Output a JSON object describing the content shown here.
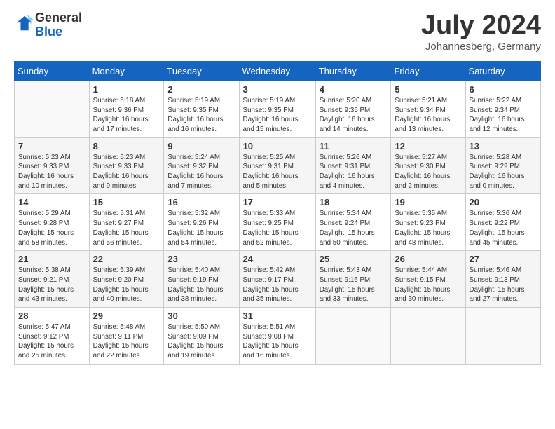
{
  "logo": {
    "general": "General",
    "blue": "Blue"
  },
  "title": "July 2024",
  "location": "Johannesberg, Germany",
  "days_of_week": [
    "Sunday",
    "Monday",
    "Tuesday",
    "Wednesday",
    "Thursday",
    "Friday",
    "Saturday"
  ],
  "weeks": [
    [
      {
        "number": "",
        "info": ""
      },
      {
        "number": "1",
        "info": "Sunrise: 5:18 AM\nSunset: 9:36 PM\nDaylight: 16 hours\nand 17 minutes."
      },
      {
        "number": "2",
        "info": "Sunrise: 5:19 AM\nSunset: 9:35 PM\nDaylight: 16 hours\nand 16 minutes."
      },
      {
        "number": "3",
        "info": "Sunrise: 5:19 AM\nSunset: 9:35 PM\nDaylight: 16 hours\nand 15 minutes."
      },
      {
        "number": "4",
        "info": "Sunrise: 5:20 AM\nSunset: 9:35 PM\nDaylight: 16 hours\nand 14 minutes."
      },
      {
        "number": "5",
        "info": "Sunrise: 5:21 AM\nSunset: 9:34 PM\nDaylight: 16 hours\nand 13 minutes."
      },
      {
        "number": "6",
        "info": "Sunrise: 5:22 AM\nSunset: 9:34 PM\nDaylight: 16 hours\nand 12 minutes."
      }
    ],
    [
      {
        "number": "7",
        "info": "Sunrise: 5:23 AM\nSunset: 9:33 PM\nDaylight: 16 hours\nand 10 minutes."
      },
      {
        "number": "8",
        "info": "Sunrise: 5:23 AM\nSunset: 9:33 PM\nDaylight: 16 hours\nand 9 minutes."
      },
      {
        "number": "9",
        "info": "Sunrise: 5:24 AM\nSunset: 9:32 PM\nDaylight: 16 hours\nand 7 minutes."
      },
      {
        "number": "10",
        "info": "Sunrise: 5:25 AM\nSunset: 9:31 PM\nDaylight: 16 hours\nand 5 minutes."
      },
      {
        "number": "11",
        "info": "Sunrise: 5:26 AM\nSunset: 9:31 PM\nDaylight: 16 hours\nand 4 minutes."
      },
      {
        "number": "12",
        "info": "Sunrise: 5:27 AM\nSunset: 9:30 PM\nDaylight: 16 hours\nand 2 minutes."
      },
      {
        "number": "13",
        "info": "Sunrise: 5:28 AM\nSunset: 9:29 PM\nDaylight: 16 hours\nand 0 minutes."
      }
    ],
    [
      {
        "number": "14",
        "info": "Sunrise: 5:29 AM\nSunset: 9:28 PM\nDaylight: 15 hours\nand 58 minutes."
      },
      {
        "number": "15",
        "info": "Sunrise: 5:31 AM\nSunset: 9:27 PM\nDaylight: 15 hours\nand 56 minutes."
      },
      {
        "number": "16",
        "info": "Sunrise: 5:32 AM\nSunset: 9:26 PM\nDaylight: 15 hours\nand 54 minutes."
      },
      {
        "number": "17",
        "info": "Sunrise: 5:33 AM\nSunset: 9:25 PM\nDaylight: 15 hours\nand 52 minutes."
      },
      {
        "number": "18",
        "info": "Sunrise: 5:34 AM\nSunset: 9:24 PM\nDaylight: 15 hours\nand 50 minutes."
      },
      {
        "number": "19",
        "info": "Sunrise: 5:35 AM\nSunset: 9:23 PM\nDaylight: 15 hours\nand 48 minutes."
      },
      {
        "number": "20",
        "info": "Sunrise: 5:36 AM\nSunset: 9:22 PM\nDaylight: 15 hours\nand 45 minutes."
      }
    ],
    [
      {
        "number": "21",
        "info": "Sunrise: 5:38 AM\nSunset: 9:21 PM\nDaylight: 15 hours\nand 43 minutes."
      },
      {
        "number": "22",
        "info": "Sunrise: 5:39 AM\nSunset: 9:20 PM\nDaylight: 15 hours\nand 40 minutes."
      },
      {
        "number": "23",
        "info": "Sunrise: 5:40 AM\nSunset: 9:19 PM\nDaylight: 15 hours\nand 38 minutes."
      },
      {
        "number": "24",
        "info": "Sunrise: 5:42 AM\nSunset: 9:17 PM\nDaylight: 15 hours\nand 35 minutes."
      },
      {
        "number": "25",
        "info": "Sunrise: 5:43 AM\nSunset: 9:16 PM\nDaylight: 15 hours\nand 33 minutes."
      },
      {
        "number": "26",
        "info": "Sunrise: 5:44 AM\nSunset: 9:15 PM\nDaylight: 15 hours\nand 30 minutes."
      },
      {
        "number": "27",
        "info": "Sunrise: 5:46 AM\nSunset: 9:13 PM\nDaylight: 15 hours\nand 27 minutes."
      }
    ],
    [
      {
        "number": "28",
        "info": "Sunrise: 5:47 AM\nSunset: 9:12 PM\nDaylight: 15 hours\nand 25 minutes."
      },
      {
        "number": "29",
        "info": "Sunrise: 5:48 AM\nSunset: 9:11 PM\nDaylight: 15 hours\nand 22 minutes."
      },
      {
        "number": "30",
        "info": "Sunrise: 5:50 AM\nSunset: 9:09 PM\nDaylight: 15 hours\nand 19 minutes."
      },
      {
        "number": "31",
        "info": "Sunrise: 5:51 AM\nSunset: 9:08 PM\nDaylight: 15 hours\nand 16 minutes."
      },
      {
        "number": "",
        "info": ""
      },
      {
        "number": "",
        "info": ""
      },
      {
        "number": "",
        "info": ""
      }
    ]
  ]
}
